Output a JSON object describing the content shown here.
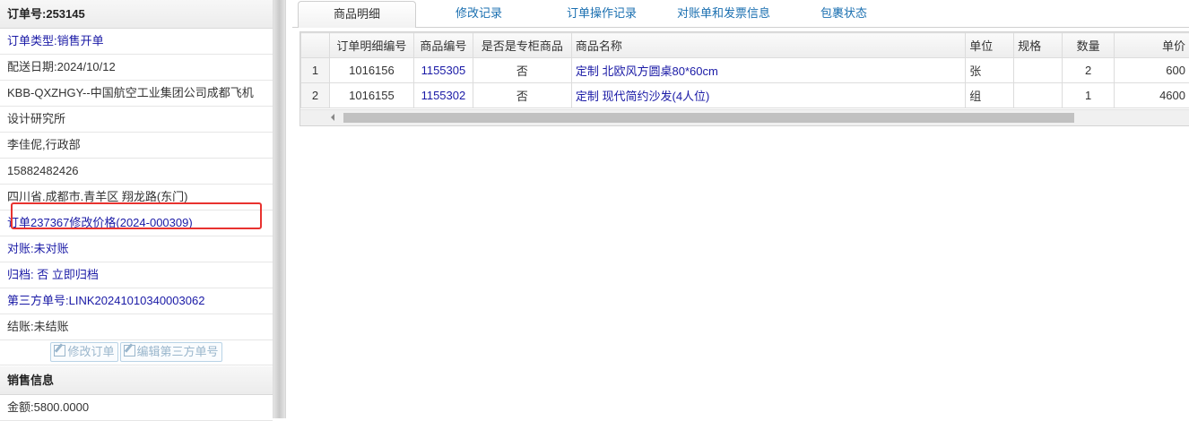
{
  "order": {
    "number_label": "订单号:",
    "number": "253145",
    "type": "订单类型:销售开单",
    "date": "配送日期:2024/10/12",
    "customer_line1": "KBB-QXZHGY--中国航空工业集团公司成都飞机",
    "customer_line2": "设计研究所",
    "contact": "李佳伲,行政部",
    "phone": "15882482426",
    "address": "四川省.成都市.青羊区 翔龙路(东门)",
    "modify_price": "订单237367修改价格(2024-000309)",
    "reconcile_label": "对账:",
    "reconcile_value": "未对账",
    "archive_label": "归档:",
    "archive_value": " 否 立即归档",
    "third_party_label": "第三方单号:",
    "third_party_value": "LINK20241010340003062",
    "settle_label": "结账:",
    "settle_value": "未结账",
    "btn_edit_order": "修改订单",
    "btn_edit_third": "编辑第三方单号"
  },
  "sales": {
    "header": "销售信息",
    "amount": "金额:5800.0000"
  },
  "tabs": [
    "商品明细",
    "修改记录",
    "订单操作记录",
    "对账单和发票信息",
    "包裹状态"
  ],
  "grid": {
    "columns": [
      "",
      "订单明细编号",
      "商品编号",
      "是否是专柜商品",
      "商品名称",
      "单位",
      "规格",
      "数量",
      "单价"
    ],
    "rows": [
      [
        "1",
        "1016156",
        "1155305",
        "否",
        "定制 北欧风方圆桌80*60cm",
        "张",
        "",
        "2",
        "600"
      ],
      [
        "2",
        "1016155",
        "1155302",
        "否",
        "定制 现代简约沙发(4人位)",
        "组",
        "",
        "1",
        "4600"
      ]
    ]
  },
  "colors": {
    "link": "#1a1aa6",
    "tab_link": "#1a6fb0",
    "highlight": "#e8322f"
  }
}
